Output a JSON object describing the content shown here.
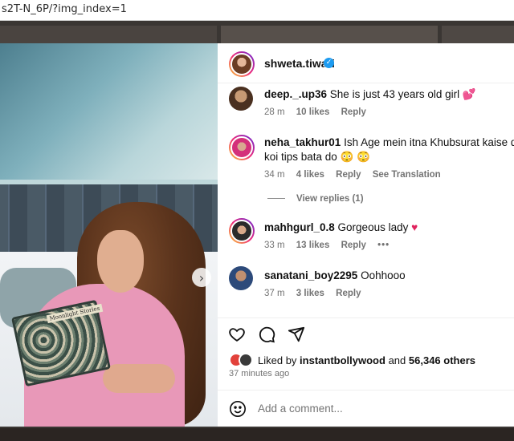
{
  "browser": {
    "url": "s2T-N_6P/?img_index=1"
  },
  "image": {
    "book_title": "Moonlight Stories",
    "carousel_count": 4,
    "carousel_active": 1
  },
  "post": {
    "author": "shweta.tiwari",
    "verified": true
  },
  "comments": [
    {
      "user": "deep._.up36",
      "text": "She is just 43 years old girl 💕",
      "time": "28 m",
      "likes": "10 likes",
      "reply": "Reply"
    },
    {
      "user": "neha_takhur01",
      "text": "Ish Age mein itna Khubsurat kaise dikh sa",
      "text2": "koi tips bata do 😳 😳",
      "time": "34 m",
      "likes": "4 likes",
      "reply": "Reply",
      "translate": "See Translation"
    },
    {
      "user": "mahhgurl_0.8",
      "text": "Gorgeous lady",
      "time": "33 m",
      "likes": "13 likes",
      "reply": "Reply",
      "more": "•••"
    },
    {
      "user": "sanatani_boy2295",
      "text": "Oohhooo",
      "time": "37 m",
      "likes": "3 likes",
      "reply": "Reply"
    }
  ],
  "view_replies": "View replies (1)",
  "likes": {
    "prefix": "Liked by",
    "user": "instantbollywood",
    "joiner": "and",
    "count": "56,346 others"
  },
  "time_ago": "37 minutes ago",
  "add_comment_placeholder": "Add a comment...",
  "colors": {
    "verified": "#1d9bf0",
    "heart": "#e0245e",
    "meta_gray": "#737373"
  }
}
